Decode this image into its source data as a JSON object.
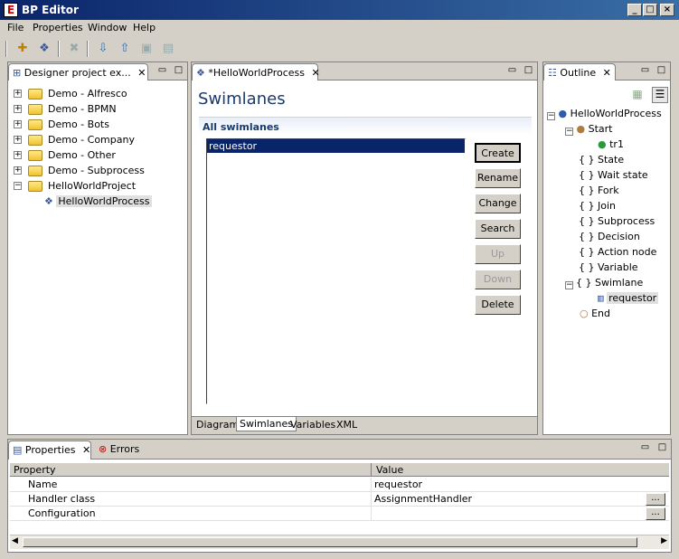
{
  "window": {
    "title": "BP Editor",
    "icon_letter": "E"
  },
  "menu": [
    "File",
    "Properties",
    "Window",
    "Help"
  ],
  "toolbar_icons": [
    "new-icon",
    "new-process-icon",
    "delete-icon",
    "import-icon",
    "export-icon",
    "save-icon",
    "save-all-icon"
  ],
  "explorer": {
    "tab_label": "Designer project ex...",
    "items": [
      {
        "label": "Demo - Alfresco"
      },
      {
        "label": "Demo - BPMN"
      },
      {
        "label": "Demo - Bots"
      },
      {
        "label": "Demo - Company"
      },
      {
        "label": "Demo - Other"
      },
      {
        "label": "Demo - Subprocess"
      },
      {
        "label": "HelloWorldProject"
      }
    ],
    "child": "HelloWorldProcess"
  },
  "editor": {
    "tab_label": "*HelloWorldProcess",
    "heading": "Swimlanes",
    "section_title": "All swimlanes",
    "list_items": [
      "requestor"
    ],
    "buttons": {
      "create": "Create",
      "rename": "Rename",
      "change": "Change",
      "search": "Search",
      "up": "Up",
      "down": "Down",
      "delete": "Delete"
    },
    "bottom_tabs": [
      "Diagram",
      "Swimlanes",
      "Variables",
      "XML"
    ],
    "active_bottom_tab": "Swimlanes"
  },
  "outline": {
    "tab_label": "Outline",
    "root": "HelloWorldProcess",
    "start": "Start",
    "transition": "tr1",
    "braces_glyph": "{ }",
    "groups": [
      "State",
      "Wait state",
      "Fork",
      "Join",
      "Subprocess",
      "Decision",
      "Action node",
      "Variable",
      "Swimlane"
    ],
    "swimlane_child": "requestor",
    "end": "End"
  },
  "properties": {
    "tab_label": "Properties",
    "errors_tab_label": "Errors",
    "col_property": "Property",
    "col_value": "Value",
    "ellipsis_label": "...",
    "rows": [
      {
        "property": "Name",
        "value": "requestor"
      },
      {
        "property": "Handler class",
        "value": "AssignmentHandler"
      },
      {
        "property": "Configuration",
        "value": ""
      }
    ]
  },
  "colors": {
    "selection": "#0a246a",
    "title_start": "#0a246a",
    "title_end": "#3a6ea5"
  }
}
